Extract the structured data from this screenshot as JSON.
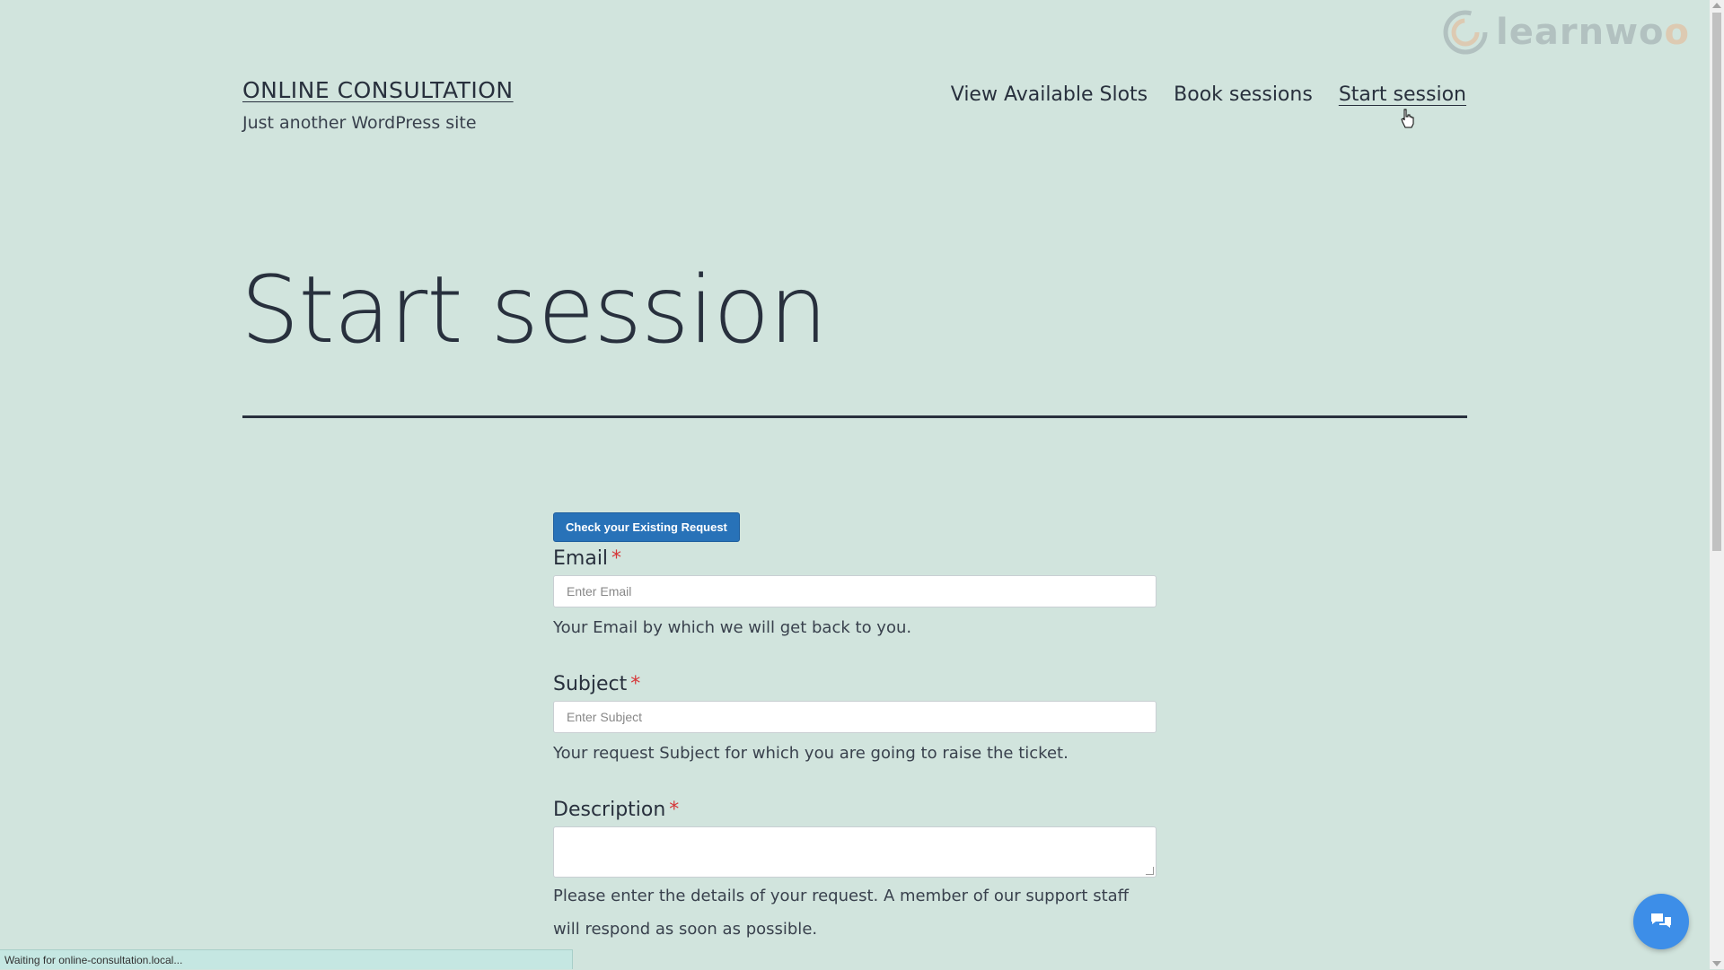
{
  "header": {
    "site_title": "ONLINE CONSULTATION",
    "tagline": "Just another WordPress site"
  },
  "nav": {
    "items": [
      {
        "label": "View Available Slots"
      },
      {
        "label": "Book sessions"
      },
      {
        "label": "Start session",
        "current": true
      }
    ]
  },
  "page": {
    "title": "Start session"
  },
  "form": {
    "check_button_label": "Check your Existing Request",
    "email": {
      "label": "Email",
      "required_mark": "*",
      "placeholder": "Enter Email",
      "value": "",
      "help": "Your Email by which we will get back to you."
    },
    "subject": {
      "label": "Subject",
      "required_mark": "*",
      "placeholder": "Enter Subject",
      "value": "",
      "help": "Your request Subject for which you are going to raise the ticket."
    },
    "description": {
      "label": "Description",
      "required_mark": "*",
      "value": "",
      "help": "Please enter the details of your request. A member of our support staff will respond as soon as possible."
    }
  },
  "watermark": {
    "text_main": "learnwo",
    "text_accent": "o"
  },
  "status_bar": {
    "text": "Waiting for online-consultation.local..."
  },
  "icons": {
    "chat": "chat-bubbles-icon",
    "logo": "learnwoo-logo-icon"
  },
  "colors": {
    "background": "#d1e4dd",
    "text": "#28303d",
    "button": "#2872b8",
    "required": "#d63638",
    "chat_button": "#3d8ee8"
  }
}
